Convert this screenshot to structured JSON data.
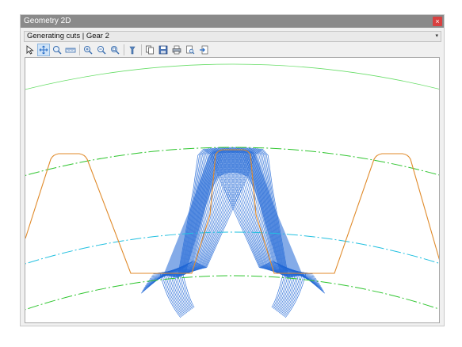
{
  "window": {
    "title": "Geometry 2D",
    "close_label": "×"
  },
  "view_select": {
    "value": "Generating cuts | Gear 2",
    "arrow": "▾"
  },
  "toolbar": {
    "tools": [
      {
        "name": "pointer-icon",
        "active": false
      },
      {
        "name": "pan-icon",
        "active": true
      },
      {
        "name": "zoom-window-icon",
        "active": false
      },
      {
        "name": "measure-icon",
        "active": false
      },
      {
        "name": "zoom-in-icon",
        "active": false
      },
      {
        "name": "zoom-out-icon",
        "active": false
      },
      {
        "name": "zoom-fit-icon",
        "active": false
      },
      {
        "name": "settings-icon",
        "active": false
      },
      {
        "name": "copy-icon",
        "active": false
      },
      {
        "name": "save-icon",
        "active": false
      },
      {
        "name": "print-icon",
        "active": false
      },
      {
        "name": "print-preview-icon",
        "active": false
      },
      {
        "name": "export-icon",
        "active": false
      }
    ]
  },
  "colors": {
    "tip_circle": "#2ec52e",
    "outer_circle": "#66dd66",
    "pitch_circle": "#22c0e0",
    "root_circle": "#2ec52e",
    "rack_profile": "#e08a2a",
    "generating_cuts": "#1f66d6"
  }
}
